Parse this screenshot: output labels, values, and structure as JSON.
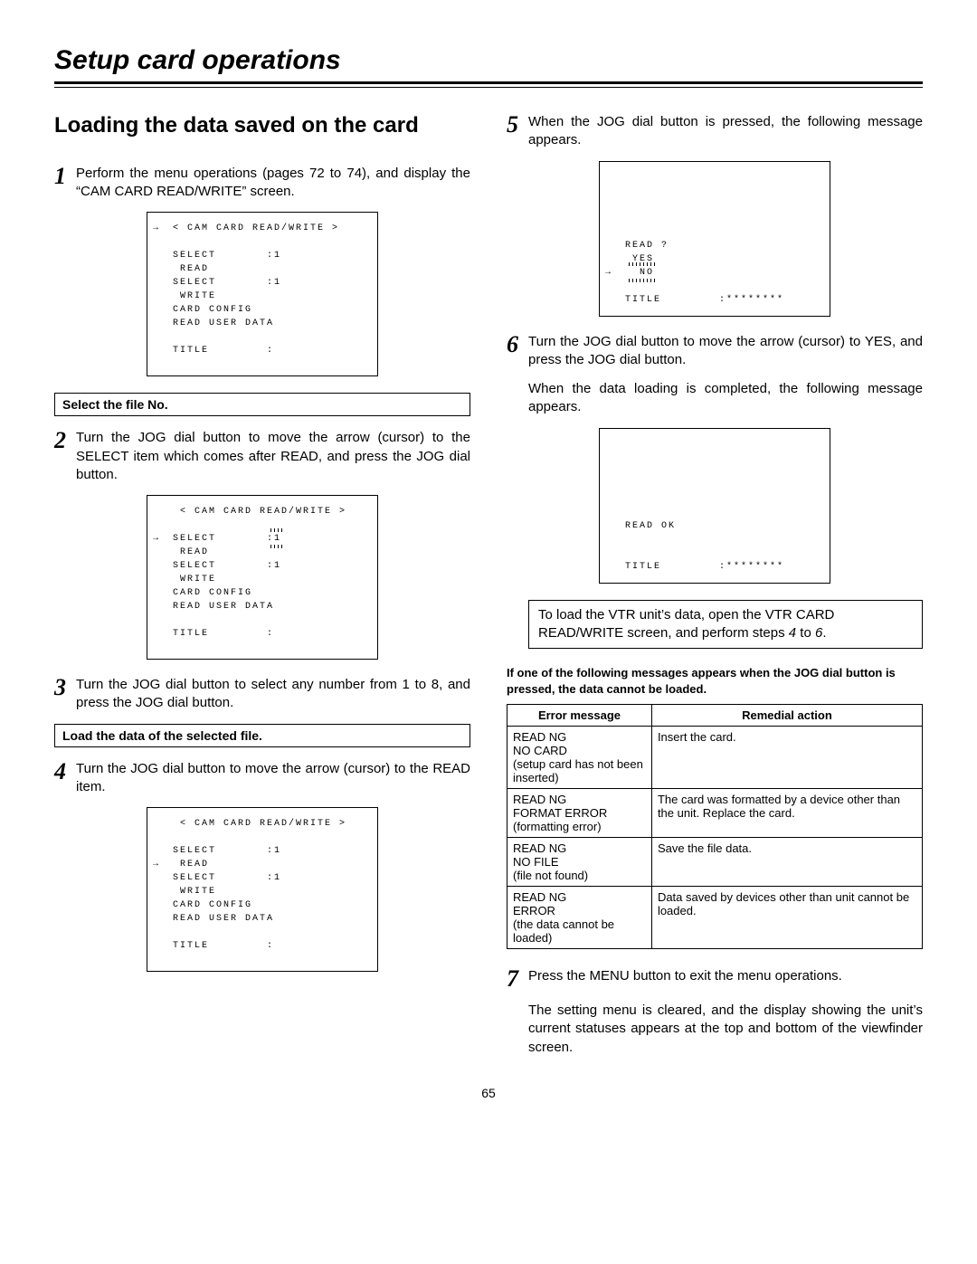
{
  "page_title": "Setup card operations",
  "section_heading": "Loading the data saved on the card",
  "page_number": "65",
  "left": {
    "step1": "Perform the menu operations (pages 72 to 74), and display the “CAM CARD READ/WRITE” screen.",
    "screen1": {
      "header": "< CAM CARD READ/WRITE >",
      "l1": "SELECT       :1",
      "l2": " READ",
      "l3": "SELECT       :1",
      "l4": " WRITE",
      "l5": "CARD CONFIG",
      "l6": "READ USER DATA",
      "l7": "TITLE        :"
    },
    "sub1": "Select the file No.",
    "step2": "Turn the JOG dial button to move the arrow (cursor) to the SELECT item which comes after READ, and press the JOG dial button.",
    "screen2_highlight": "1",
    "step3": "Turn the JOG dial button to select any number from 1 to 8, and press the JOG dial button.",
    "sub2": "Load the data of the selected file.",
    "step4": "Turn the JOG dial button to move the arrow (cursor) to the READ item."
  },
  "right": {
    "step5": "When the JOG dial button is pressed, the following message appears.",
    "screen5": {
      "l1": "READ ?",
      "l2": " YES",
      "l3": " NO",
      "l4": "TITLE        :********"
    },
    "step6a": "Turn the JOG dial button to move the arrow (cursor) to YES, and press the JOG dial button.",
    "step6b": "When the data loading is completed, the following message appears.",
    "screen6": {
      "l1": "READ OK",
      "l2": "TITLE        :********"
    },
    "note": "To load the VTR unit’s data, open the VTR CARD READ/WRITE screen, and perform steps 4 to 6.",
    "warn": "If one of the following messages appears when the JOG dial button is pressed, the data cannot be loaded.",
    "table": {
      "head1": "Error message",
      "head2": "Remedial action",
      "rows": [
        {
          "msg": "READ NG\nNO CARD\n(setup card has not been inserted)",
          "fix": "Insert the card."
        },
        {
          "msg": "READ NG\nFORMAT ERROR\n(formatting error)",
          "fix": "The card was formatted by a device other than the unit. Replace the card."
        },
        {
          "msg": "READ NG\nNO FILE\n(file not found)",
          "fix": "Save the file data."
        },
        {
          "msg": "READ NG\nERROR\n(the data cannot be loaded)",
          "fix": "Data saved by devices other than unit cannot be loaded."
        }
      ]
    },
    "step7a": "Press the MENU button to exit the menu operations.",
    "step7b": "The setting menu is cleared, and the display showing the unit’s current statuses appears at the top and bottom of the viewfinder screen."
  }
}
